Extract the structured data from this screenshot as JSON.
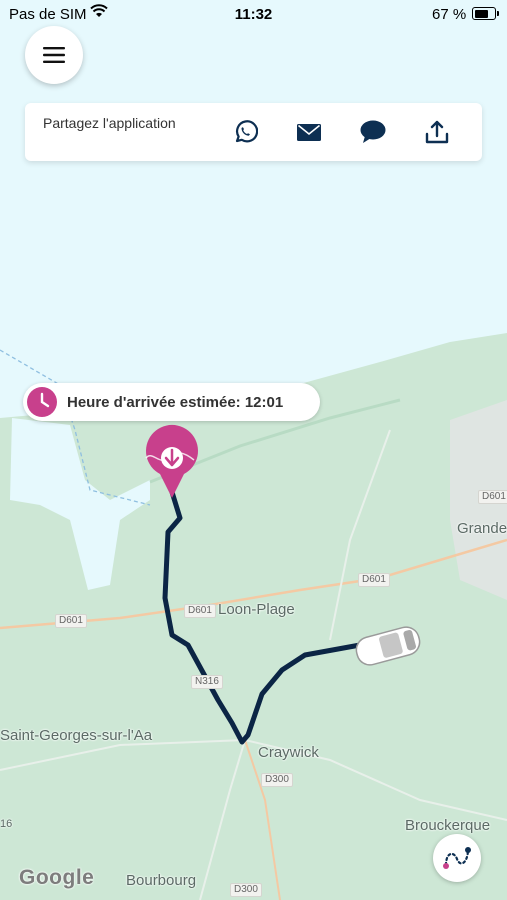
{
  "status_bar": {
    "carrier": "Pas de SIM",
    "time": "11:32",
    "battery_percent": "67 %",
    "battery_level": 0.67
  },
  "menu": {
    "icon": "hamburger-menu-icon"
  },
  "share": {
    "title": "Partagez l'application",
    "buttons": [
      {
        "name": "whatsapp",
        "icon": "whatsapp-icon"
      },
      {
        "name": "email",
        "icon": "envelope-icon"
      },
      {
        "name": "sms",
        "icon": "chat-bubble-icon"
      },
      {
        "name": "share",
        "icon": "share-upload-icon"
      }
    ]
  },
  "eta": {
    "icon": "clock-icon",
    "text": "Heure d'arrivée estimée: 12:01"
  },
  "map": {
    "places": {
      "loon_plage": "Loon-Plage",
      "grande": "Grande",
      "saint_georges": "Saint-Georges-sur-l'Aa",
      "craywick": "Craywick",
      "brouckerque": "Brouckerque",
      "bourbourg": "Bourbourg",
      "edge_number": "16"
    },
    "roads": {
      "d601_west": "D601",
      "d601_center": "D601",
      "d601_east": "D601",
      "d601_far_east": "D601",
      "n316": "N316",
      "d300_a": "D300",
      "d300_b": "D300"
    },
    "attribution": "Google"
  },
  "colors": {
    "accent": "#c8408c",
    "route": "#0b2545",
    "icon": "#0d2f52",
    "land": "#cde7d5",
    "water": "#e6f9fd"
  }
}
